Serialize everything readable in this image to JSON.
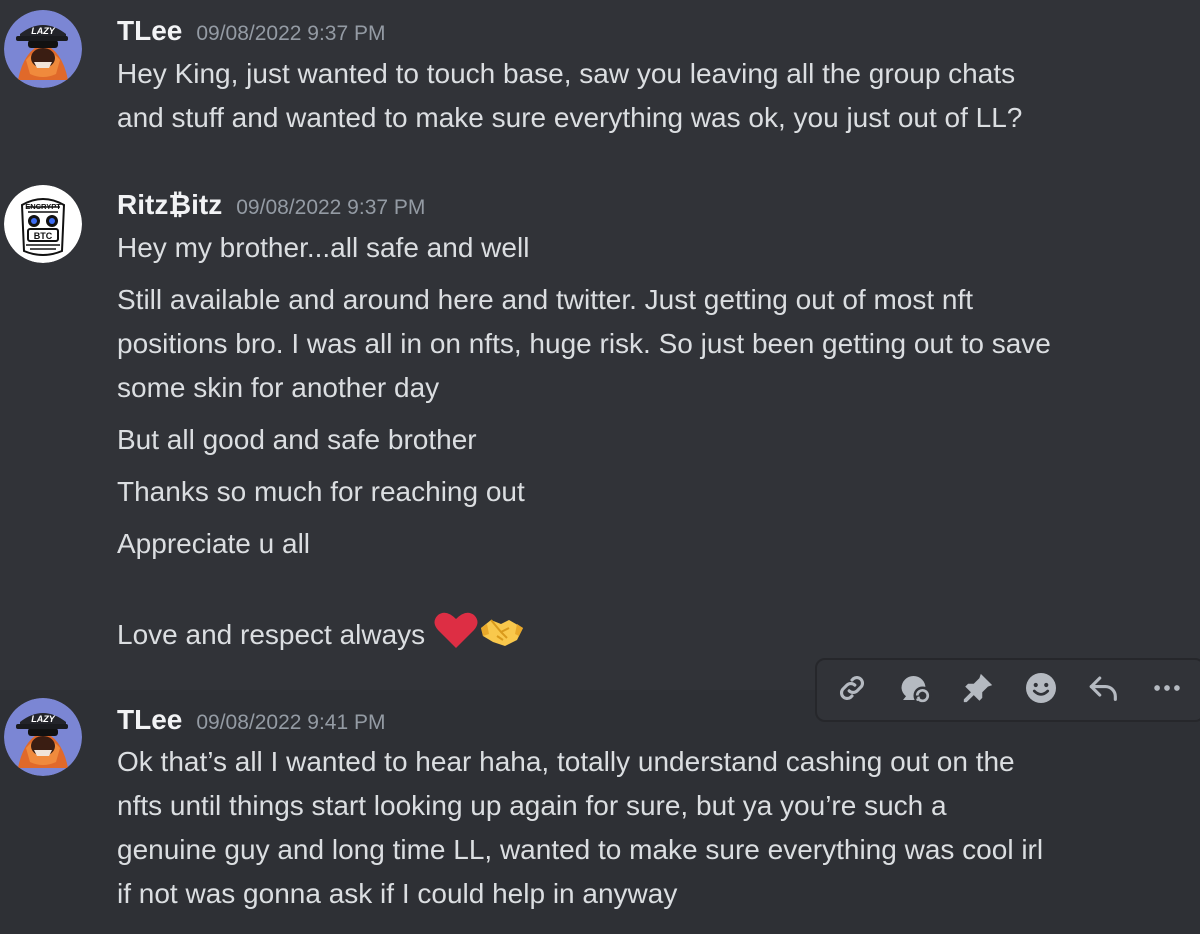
{
  "messages": [
    {
      "username": "TLee",
      "timestamp": "09/08/2022 9:37 PM",
      "lines": [
        "Hey King, just wanted to touch base, saw you leaving all the group chats",
        "and stuff and wanted to make sure everything was ok, you just out of LL?"
      ]
    },
    {
      "username": "Ritz₿itz",
      "timestamp": "09/08/2022 9:37 PM",
      "lines": [
        "Hey my brother...all safe and well",
        "Still available and around here and twitter. Just getting out of most nft",
        "positions bro. I was all in on nfts, huge risk. So just been getting out to save",
        "some skin for another day",
        "But all good and safe brother",
        "Thanks so much for reaching out",
        "Appreciate u all",
        "Love and respect always"
      ],
      "avatar_text": [
        "ENCRYPT",
        "BTC"
      ]
    },
    {
      "username": "TLee",
      "timestamp": "09/08/2022 9:41 PM",
      "lines": [
        "Ok that’s all I wanted to hear haha, totally understand cashing out on the",
        "nfts until things start looking up again for sure, but ya you’re such a",
        "genuine guy and long time LL, wanted to make sure everything was cool irl",
        "if not was gonna ask if I could help in anyway"
      ]
    }
  ],
  "avatars": {
    "tlee_cap_text": "LAZY"
  },
  "toolbar": {
    "icons": [
      "link-icon",
      "create-thread-icon",
      "pin-icon",
      "add-reaction-icon",
      "reply-icon",
      "more-icon"
    ]
  },
  "colors": {
    "background": "#313338",
    "hover_background": "#2e3035",
    "username": "#f2f3f5",
    "timestamp": "#949ba4",
    "text": "#dbdee1"
  }
}
